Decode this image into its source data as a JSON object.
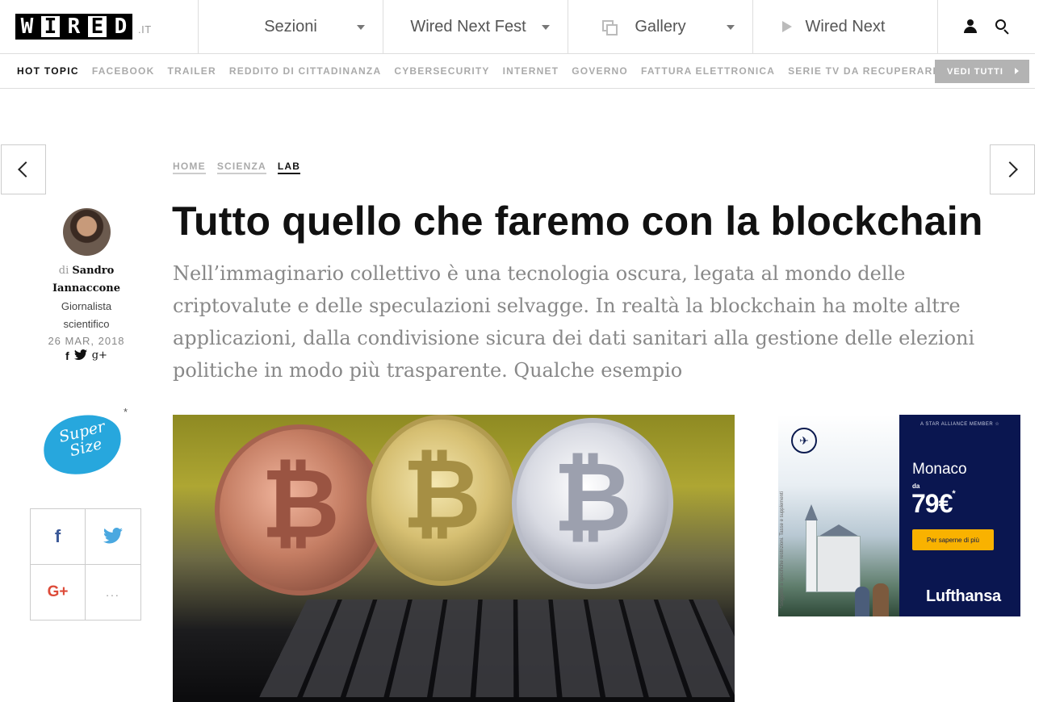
{
  "header": {
    "logo_letters": [
      "W",
      "I",
      "R",
      "E",
      "D"
    ],
    "logo_tld": ".IT",
    "nav": [
      {
        "label": "Sezioni"
      },
      {
        "label": "Wired Next Fest"
      },
      {
        "label": "Gallery",
        "icon": "gallery-icon"
      },
      {
        "label": "Wired Next",
        "icon": "play-icon"
      }
    ],
    "tools": [
      "user-icon",
      "search-icon"
    ]
  },
  "hot_topics": {
    "label": "HOT TOPIC",
    "items": [
      "FACEBOOK",
      "TRAILER",
      "REDDITO DI CITTADINANZA",
      "CYBERSECURITY",
      "INTERNET",
      "GOVERNO",
      "FATTURA ELETTRONICA",
      "SERIE TV DA RECUPERARE"
    ],
    "see_all": "VEDI TUTTI"
  },
  "article": {
    "breadcrumb": [
      "HOME",
      "SCIENZA",
      "LAB"
    ],
    "title": "Tutto quello che faremo con la blockchain",
    "subtitle": "Nell’immaginario collettivo è una tecnologia oscura, legata al mondo delle criptovalute e delle speculazioni selvagge. In realtà la blockchain ha molte altre applicazioni, dalla condivisione sicura dei dati sanitari alla gestione delle elezioni politiche in modo più trasparente. Qualche esempio"
  },
  "author": {
    "prefix": "di",
    "first_name": "Sandro",
    "last_name": "Iannaccone",
    "role_line1": "Giornalista",
    "role_line2": "scientifico",
    "date": "26 MAR, 2018",
    "social": [
      "f",
      "g+"
    ]
  },
  "supersize": {
    "line1": "Super",
    "line2": "Size",
    "mark": "*"
  },
  "share": {
    "facebook": "f",
    "googleplus": "G+",
    "more": "..."
  },
  "hero": {
    "coin_symbol": "₿"
  },
  "ad": {
    "alliance": "A STAR ALLIANCE MEMBER ☆",
    "city": "Monaco",
    "from": "da",
    "price": "79€",
    "price_mark": "*",
    "cta": "Per saperne di più",
    "brand": "Lufthansa",
    "fineprint": "*Soggetto a specifiche restrizioni. Tasse e supplementi"
  },
  "colors": {
    "ad_navy": "#0a1650",
    "ad_cta": "#f9b200",
    "supersize_blue": "#27a7dd",
    "facebook": "#3b5998",
    "twitter": "#4aa8e0",
    "googleplus": "#dd4b39"
  }
}
